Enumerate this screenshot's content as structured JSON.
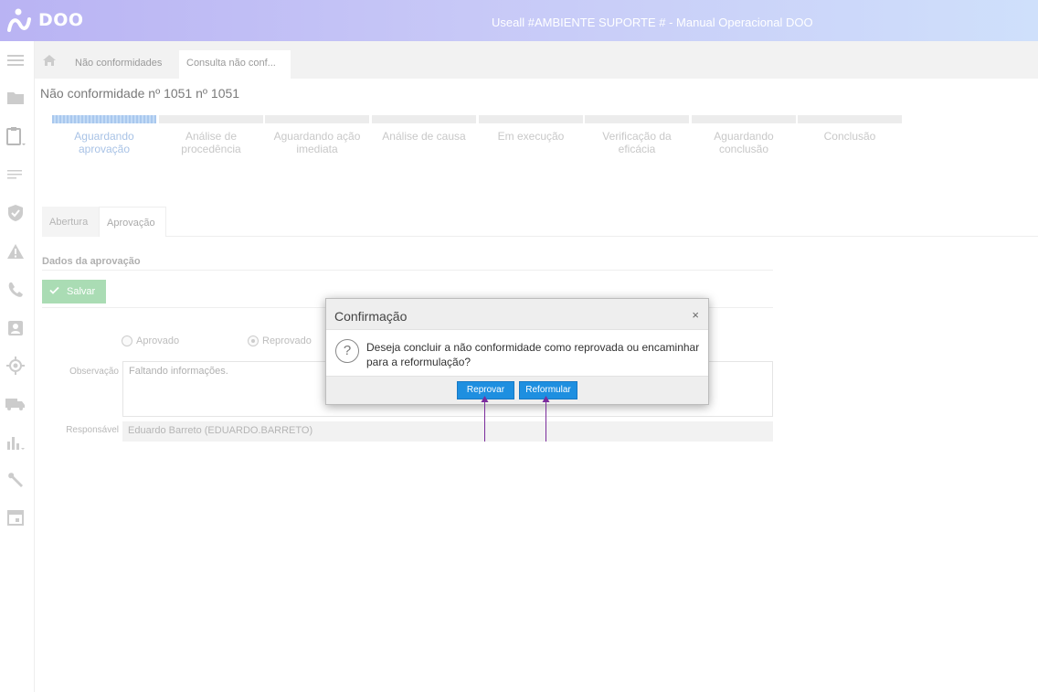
{
  "app": {
    "logo_text": "DOO",
    "title": "Useall #AMBIENTE SUPORTE # - Manual Operacional DOO"
  },
  "breadcrumb": {
    "items": [
      "Não conformidades",
      "Consulta não conf..."
    ]
  },
  "page": {
    "title": "Não conformidade nº 1051 nº 1051"
  },
  "steps": [
    {
      "label": "Aguardando aprovação",
      "active": true
    },
    {
      "label": "Análise de procedência",
      "active": false
    },
    {
      "label": "Aguardando ação imediata",
      "active": false
    },
    {
      "label": "Análise de causa",
      "active": false
    },
    {
      "label": "Em execução",
      "active": false
    },
    {
      "label": "Verificação da eficácia",
      "active": false
    },
    {
      "label": "Aguardando conclusão",
      "active": false
    },
    {
      "label": "Conclusão",
      "active": false
    }
  ],
  "tabs": {
    "abertura": "Abertura",
    "aprovacao": "Aprovação"
  },
  "form": {
    "section_title": "Dados da aprovação",
    "save_label": "Salvar",
    "radio_aprovado": "Aprovado",
    "radio_reprovado": "Reprovado",
    "selected": "Reprovado",
    "observacao_label": "Observação",
    "observacao_value": "Faltando informações.",
    "responsavel_label": "Responsável",
    "responsavel_value": "Eduardo Barreto (EDUARDO.BARRETO)"
  },
  "dialog": {
    "title": "Confirmação",
    "close": "×",
    "icon": "?",
    "message": "Deseja concluir a não conformidade como reprovada ou encaminhar para a reformulação?",
    "btn_reprovar": "Reprovar",
    "btn_reformular": "Reformular"
  },
  "sidebar_icons": [
    "menu-icon",
    "folder-icon",
    "clipboard-icon",
    "list-icon",
    "shield-icon",
    "warning-icon",
    "phone-icon",
    "contact-icon",
    "target-icon",
    "truck-icon",
    "chart-icon",
    "wrench-icon",
    "calendar-icon"
  ],
  "colors": {
    "topbar_start": "#b9b3f3",
    "topbar_end": "#cfe0fb",
    "primary_button": "#1e8fe0",
    "save_button": "#aadcb4",
    "annotation_arrow": "#7b2d9c"
  }
}
